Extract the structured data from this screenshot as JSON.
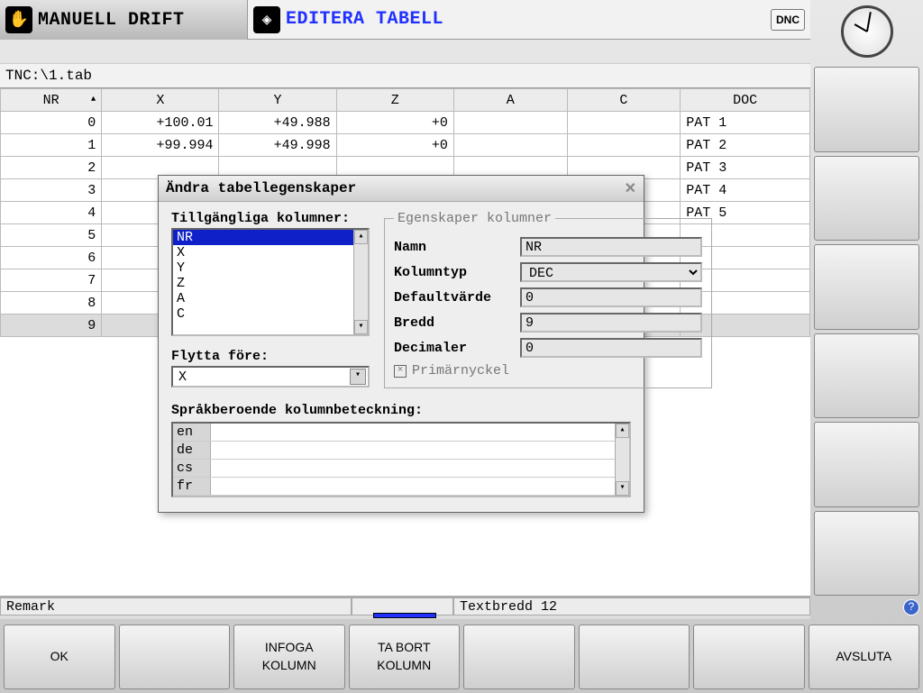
{
  "topbar": {
    "primary_mode": "MANUELL DRIFT",
    "secondary_mode": "EDITERA TABELL",
    "dnc": "DNC"
  },
  "path": "TNC:\\1.tab",
  "table": {
    "headers": {
      "nr": "NR",
      "x": "X",
      "y": "Y",
      "z": "Z",
      "a": "A",
      "c": "C",
      "doc": "DOC"
    },
    "rows": [
      {
        "nr": "0",
        "x": "+100.01",
        "y": "+49.988",
        "z": "+0",
        "a": "",
        "c": "",
        "doc": "PAT 1"
      },
      {
        "nr": "1",
        "x": "+99.994",
        "y": "+49.998",
        "z": "+0",
        "a": "",
        "c": "",
        "doc": "PAT 2"
      },
      {
        "nr": "2",
        "x": "",
        "y": "",
        "z": "",
        "a": "",
        "c": "",
        "doc": "PAT 3"
      },
      {
        "nr": "3",
        "x": "",
        "y": "",
        "z": "",
        "a": "",
        "c": "",
        "doc": "PAT 4"
      },
      {
        "nr": "4",
        "x": "",
        "y": "",
        "z": "",
        "a": "",
        "c": "",
        "doc": "PAT 5"
      },
      {
        "nr": "5",
        "x": "",
        "y": "",
        "z": "",
        "a": "",
        "c": "",
        "doc": ""
      },
      {
        "nr": "6",
        "x": "",
        "y": "",
        "z": "",
        "a": "",
        "c": "",
        "doc": ""
      },
      {
        "nr": "7",
        "x": "",
        "y": "",
        "z": "",
        "a": "",
        "c": "",
        "doc": ""
      },
      {
        "nr": "8",
        "x": "",
        "y": "",
        "z": "",
        "a": "",
        "c": "",
        "doc": ""
      },
      {
        "nr": "9",
        "x": "",
        "y": "",
        "z": "",
        "a": "",
        "c": "",
        "doc": ""
      }
    ]
  },
  "dialog": {
    "title": "Ändra tabellegenskaper",
    "available_label": "Tillgängliga kolumner:",
    "available": [
      "NR",
      "X",
      "Y",
      "Z",
      "A",
      "C"
    ],
    "selected_available": "NR",
    "props_legend": "Egenskaper kolumner",
    "name_label": "Namn",
    "name_value": "NR",
    "type_label": "Kolumntyp",
    "type_value": "DEC",
    "default_label": "Defaultvärde",
    "default_value": "0",
    "width_label": "Bredd",
    "width_value": "9",
    "decimals_label": "Decimaler",
    "decimals_value": "0",
    "primary_key_label": "Primärnyckel",
    "primary_key_checked": "×",
    "move_before_label": "Flytta före:",
    "move_before_value": "X",
    "lang_label": "Språkberoende kolumnbeteckning:",
    "lang_rows": [
      {
        "code": "en",
        "val": ""
      },
      {
        "code": "de",
        "val": ""
      },
      {
        "code": "cs",
        "val": ""
      },
      {
        "code": "fr",
        "val": ""
      }
    ]
  },
  "status": {
    "remark": "Remark",
    "textwidth": "Textbredd 12"
  },
  "softkeys": {
    "b0": "OK",
    "b1": "",
    "b2_l1": "INFOGA",
    "b2_l2": "KOLUMN",
    "b3_l1": "TA BORT",
    "b3_l2": "KOLUMN",
    "b4": "",
    "b5": "",
    "b6": "",
    "b7": "AVSLUTA"
  }
}
